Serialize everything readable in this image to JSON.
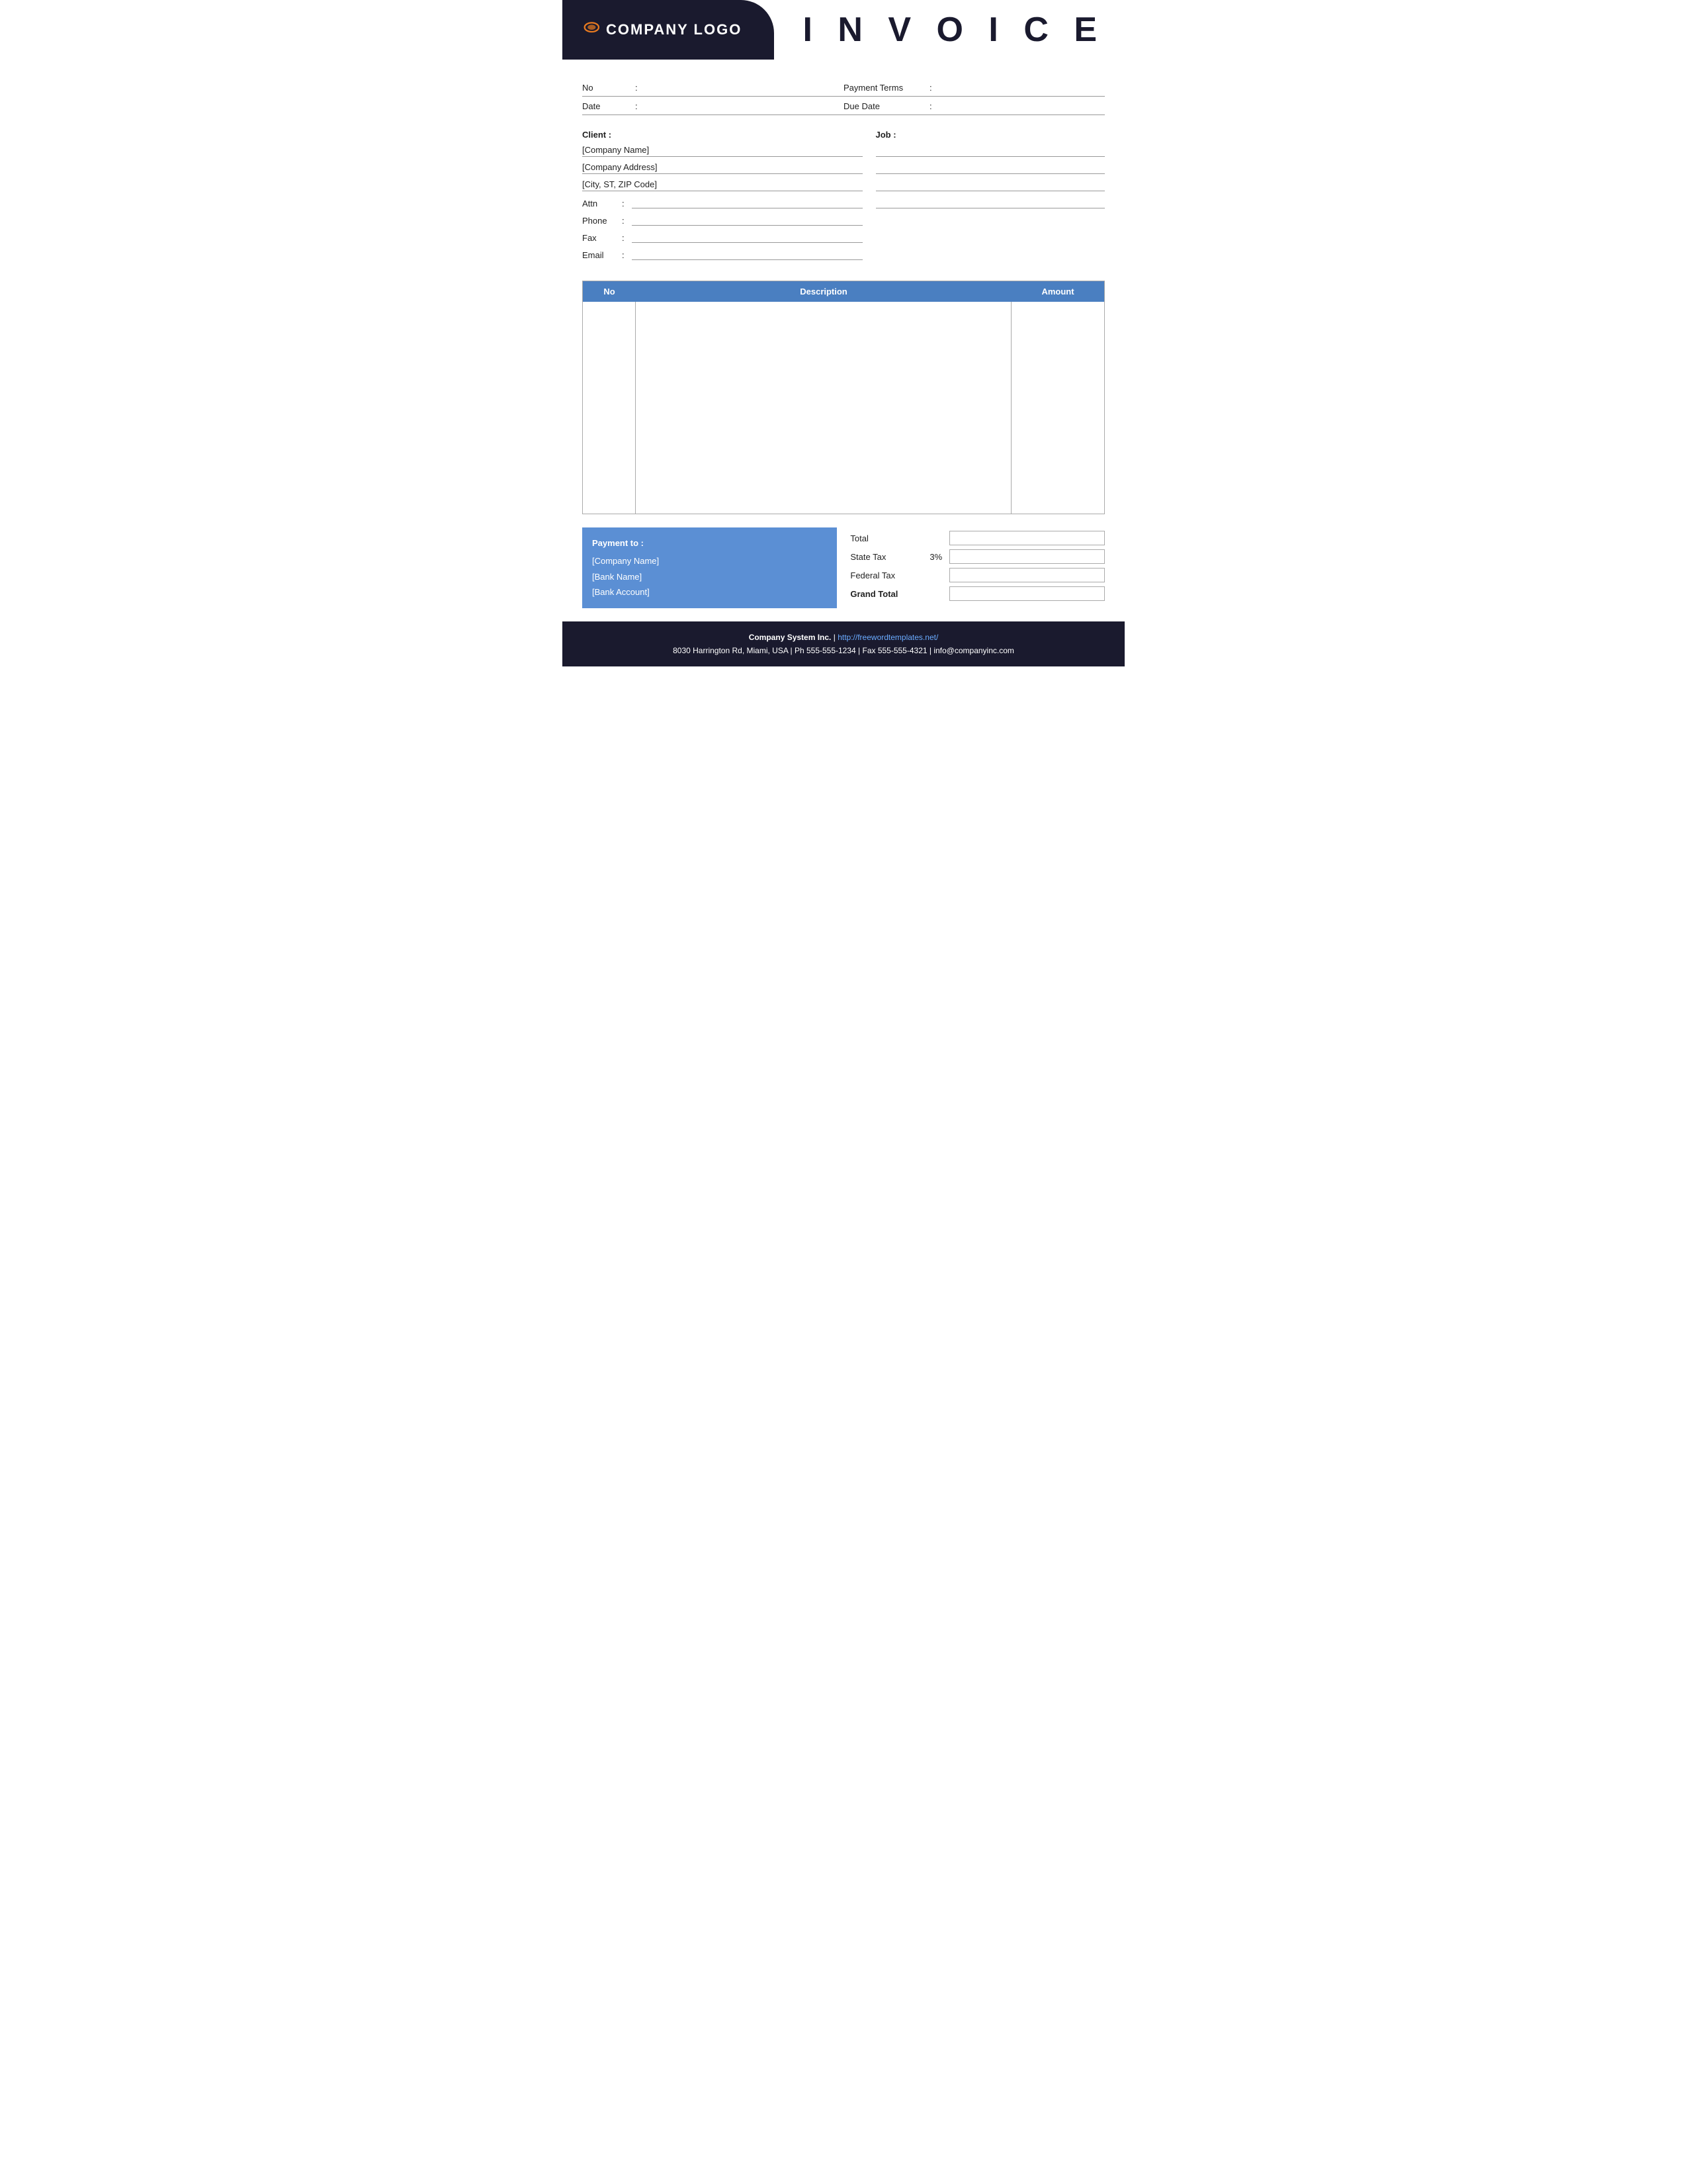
{
  "header": {
    "logo_text": "COMPANY LOGO",
    "invoice_title": "I N V O I C E"
  },
  "info": {
    "no_label": "No",
    "no_colon": ":",
    "payment_terms_label": "Payment  Terms",
    "payment_terms_colon": ":",
    "date_label": "Date",
    "date_colon": ":",
    "due_date_label": "Due Date",
    "due_date_colon": ":"
  },
  "client": {
    "label": "Client :",
    "company_name": "[Company Name]",
    "company_address": "[Company Address]",
    "city": "[City, ST, ZIP Code]",
    "attn_label": "Attn",
    "attn_colon": ":",
    "phone_label": "Phone",
    "phone_colon": ":",
    "fax_label": "Fax",
    "fax_colon": ":",
    "email_label": "Email",
    "email_colon": ":"
  },
  "job": {
    "label": "Job :",
    "lines": [
      "",
      "",
      "",
      ""
    ]
  },
  "table": {
    "col_no": "No",
    "col_desc": "Description",
    "col_amount": "Amount"
  },
  "payment": {
    "title": "Payment to :",
    "company_name": "[Company Name]",
    "bank_name": "[Bank Name]",
    "bank_account": "[Bank Account]"
  },
  "totals": {
    "total_label": "Total",
    "state_tax_label": "State Tax",
    "state_tax_pct": "3%",
    "federal_tax_label": "Federal Tax",
    "grand_total_label": "Grand Total"
  },
  "footer": {
    "company": "Company System Inc.",
    "separator": " | ",
    "website": "http://freewordtemplates.net/",
    "address": "8030 Harrington Rd, Miami, USA | Ph 555-555-1234 | Fax 555-555-4321 | info@companyinc.com"
  }
}
